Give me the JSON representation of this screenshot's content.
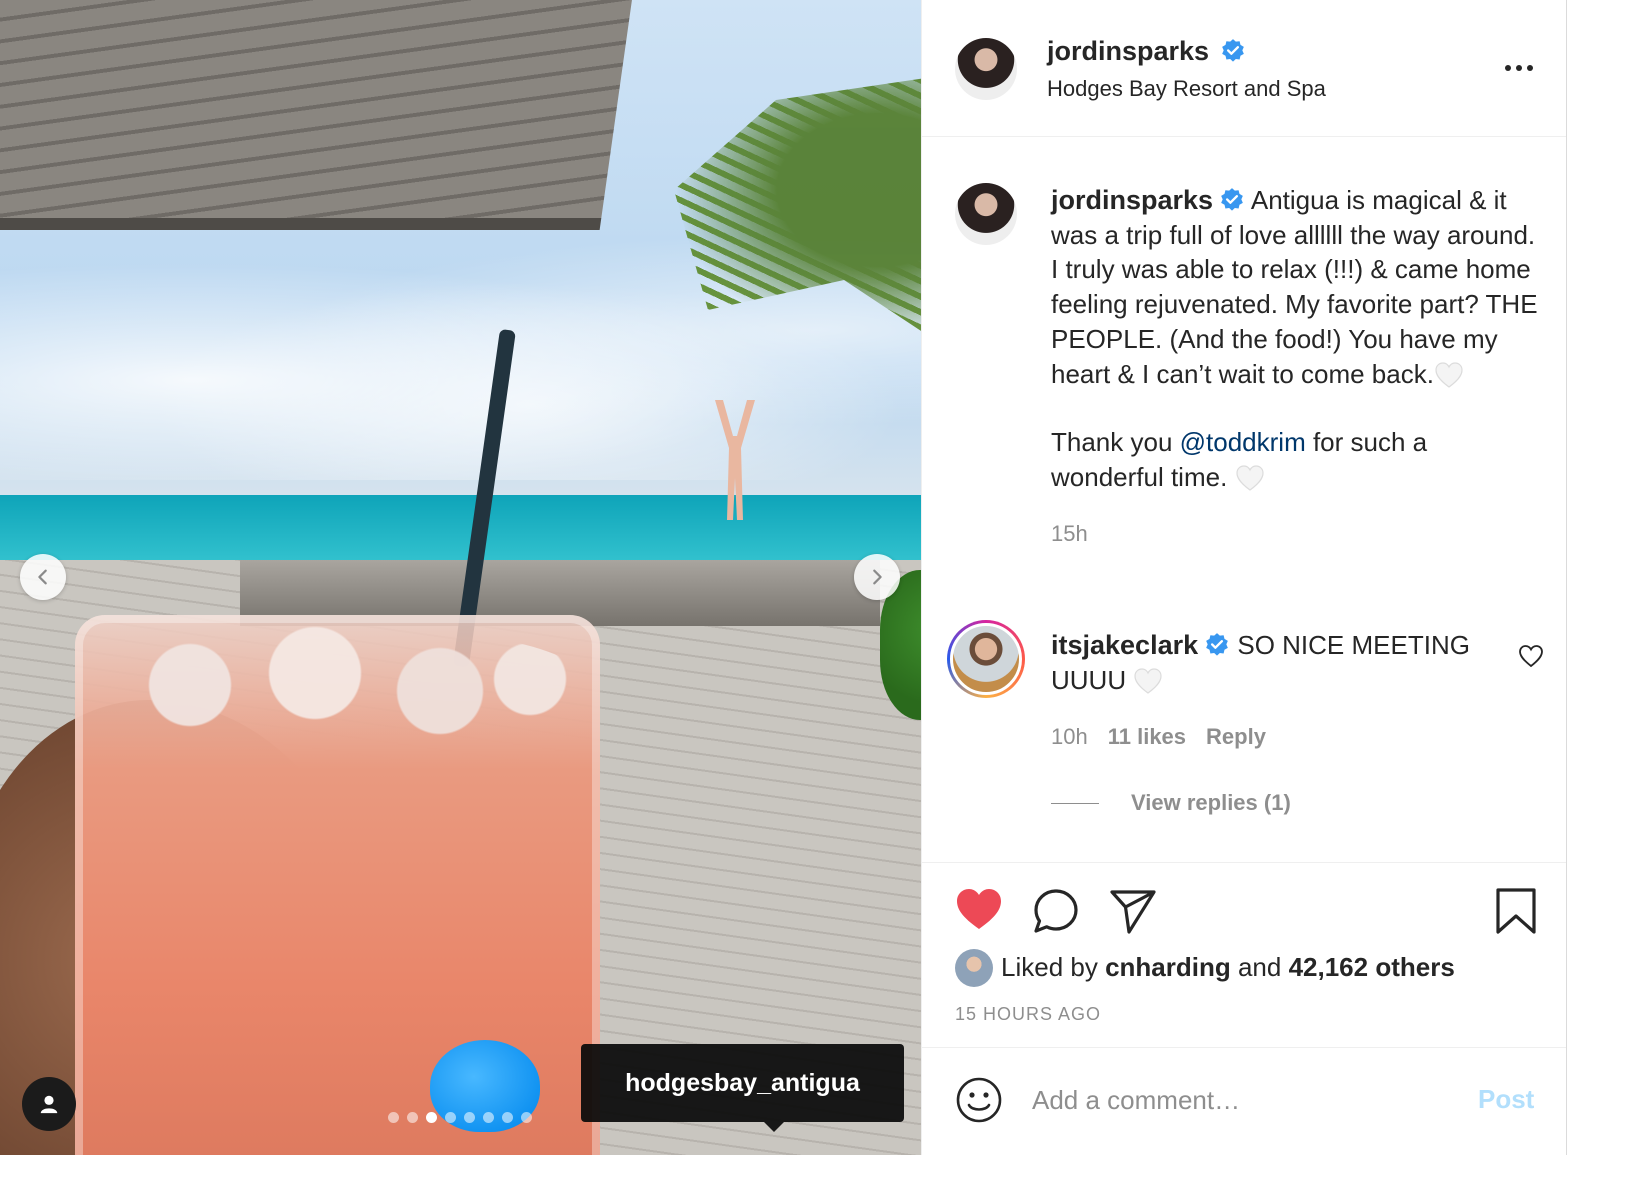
{
  "post": {
    "location_tag": "hodgesbay_antigua",
    "carousel": {
      "total": 8,
      "active_index": 2
    }
  },
  "header": {
    "username": "jordinsparks",
    "location": "Hodges Bay Resort and Spa"
  },
  "caption": {
    "username": "jordinsparks",
    "text_part1": "Antigua is magical & it was a trip full of love allllll the way around. I truly was able to relax (!!!) & came home feeling rejuvenated. My favorite part? THE PEOPLE. (And the food!) You have my heart & I can’t wait to come back.",
    "text_part2_prefix": "Thank you ",
    "mention": "@toddkrim",
    "text_part2_suffix": " for such a wonderful time.",
    "time": "15h"
  },
  "comment": {
    "username": "itsjakeclark",
    "text": "SO NICE MEETING UUUU",
    "time": "10h",
    "likes": "11 likes",
    "reply_label": "Reply",
    "view_replies": "View replies (1)"
  },
  "actions": {
    "liked_by_prefix": "Liked by ",
    "liked_by_user": "cnharding",
    "liked_by_and": " and ",
    "liked_by_others": "42,162 others",
    "posted_ago": "15 HOURS AGO"
  },
  "add_comment": {
    "placeholder": "Add a comment…",
    "post_label": "Post"
  },
  "icons": {
    "verified": "verified-badge-icon",
    "like": "heart-filled-icon",
    "comment": "comment-bubble-icon",
    "share": "paper-plane-icon",
    "save": "bookmark-icon",
    "emoji": "smiley-icon",
    "more": "more-options-icon",
    "prev": "chevron-left-icon",
    "next": "chevron-right-icon",
    "user_tag": "person-icon"
  },
  "colors": {
    "like_red": "#ed4956",
    "link_blue": "#00376b",
    "verified_blue": "#3897f0",
    "post_disabled": "#b2dffc",
    "secondary_text": "#8e8e8e"
  }
}
